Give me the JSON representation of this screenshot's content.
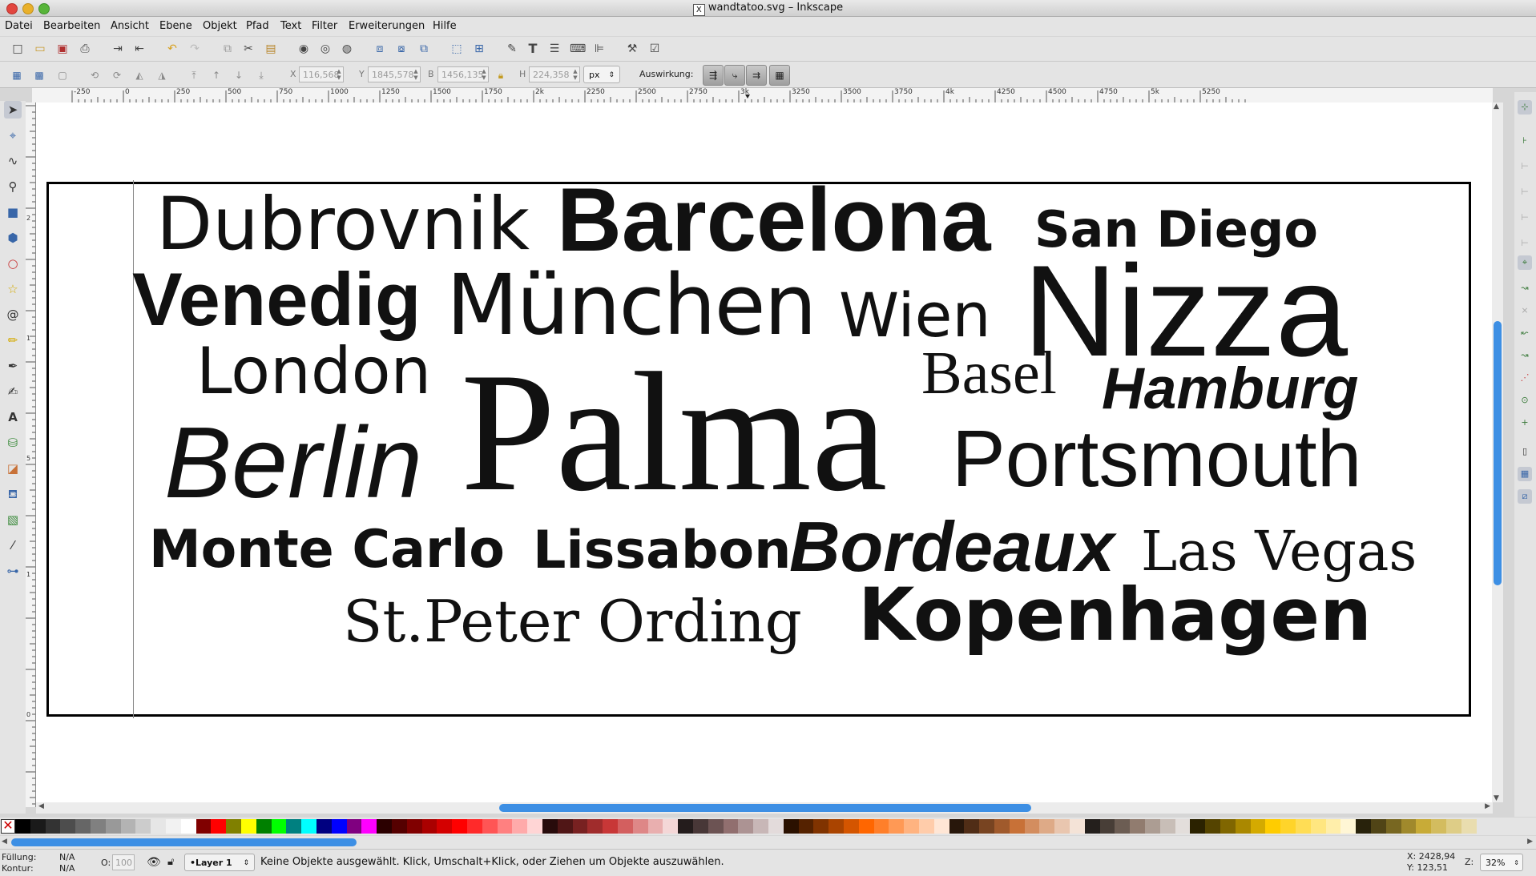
{
  "window": {
    "title": "wandtatoo.svg – Inkscape",
    "x11_glyph": "X"
  },
  "menu": [
    "Datei",
    "Bearbeiten",
    "Ansicht",
    "Ebene",
    "Objekt",
    "Pfad",
    "Text",
    "Filter",
    "Erweiterungen",
    "Hilfe"
  ],
  "toolbar1": {
    "icons": [
      "new-document-icon",
      "open-icon",
      "save-icon",
      "print-icon",
      "import-icon",
      "export-icon",
      "undo-icon",
      "redo-icon",
      "duplicate-icon",
      "cut-icon",
      "paste-icon",
      "zoom-selection-icon",
      "zoom-drawing-icon",
      "zoom-page-icon",
      "group-icon",
      "ungroup-icon",
      "clone-icon",
      "zoom-fit-icon",
      "zoom-1to1-icon",
      "fill-stroke-icon",
      "text-tool-icon",
      "layers-icon",
      "xml-editor-icon",
      "align-icon",
      "preferences-icon",
      "document-properties-icon"
    ]
  },
  "toolbar2": {
    "x_label": "X",
    "x_value": "116,568",
    "y_label": "Y",
    "y_value": "1845,578",
    "w_label": "B",
    "w_value": "1456,135",
    "h_label": "H",
    "h_value": "224,358",
    "unit": "px",
    "affect_label": "Auswirkung:"
  },
  "ruler_h": {
    "labels": [
      "-250",
      "0",
      "250",
      "500",
      "750",
      "1000",
      "1250",
      "1500",
      "1750",
      "2k",
      "2250",
      "2500",
      "2750",
      "3k",
      "3250",
      "3500",
      "3750",
      "4k",
      "4250",
      "4500",
      "4750",
      "5k",
      "5250"
    ]
  },
  "ruler_v": {
    "labels": [
      "2",
      "1",
      "5",
      "1",
      "0",
      "5",
      "0"
    ]
  },
  "canvas": {
    "words": [
      {
        "text": "Dubrovnik"
      },
      {
        "text": "Barcelona"
      },
      {
        "text": "San Diego"
      },
      {
        "text": "Venedig"
      },
      {
        "text": "München"
      },
      {
        "text": "Wien"
      },
      {
        "text": "Nizza"
      },
      {
        "text": "London"
      },
      {
        "text": "Basel"
      },
      {
        "text": "Hamburg"
      },
      {
        "text": "Palma"
      },
      {
        "text": "Berlin"
      },
      {
        "text": "Portsmouth"
      },
      {
        "text": "Monte Carlo"
      },
      {
        "text": "Lissabon"
      },
      {
        "text": "Bordeaux"
      },
      {
        "text": "Las Vegas"
      },
      {
        "text": "St.Peter Ording"
      },
      {
        "text": "Kopenhagen"
      }
    ]
  },
  "palette": {
    "colors": [
      "#000000",
      "#1a1a1a",
      "#333333",
      "#4d4d4d",
      "#666666",
      "#808080",
      "#999999",
      "#b3b3b3",
      "#cccccc",
      "#e6e6e6",
      "#f2f2f2",
      "#ffffff",
      "#800000",
      "#ff0000",
      "#808000",
      "#ffff00",
      "#008000",
      "#00ff00",
      "#008080",
      "#00ffff",
      "#000080",
      "#0000ff",
      "#800080",
      "#ff00ff",
      "#2b0000",
      "#550000",
      "#800000",
      "#aa0000",
      "#d40000",
      "#ff0000",
      "#ff2a2a",
      "#ff5555",
      "#ff8080",
      "#ffaaaa",
      "#ffd5d5",
      "#280b0b",
      "#501616",
      "#782121",
      "#a02c2c",
      "#c83737",
      "#d35f5f",
      "#de8787",
      "#e9afaf",
      "#f4d7d7",
      "#241c1c",
      "#483737",
      "#6c5353",
      "#916f6f",
      "#ac9393",
      "#c8b7b7",
      "#e3dbdb",
      "#2b1100",
      "#552200",
      "#803300",
      "#aa4400",
      "#d45500",
      "#ff6600",
      "#ff7f2a",
      "#ff9955",
      "#ffb380",
      "#ffccaa",
      "#ffe6d5",
      "#28170b",
      "#502d16",
      "#784421",
      "#a05a2c",
      "#c87137",
      "#d38d5f",
      "#deaa87",
      "#e9c6af",
      "#f4e3d7",
      "#241f1c",
      "#483e37",
      "#6c5d53",
      "#917c6f",
      "#ac9d93",
      "#c8beb7",
      "#e3dedb",
      "#2b2200",
      "#554400",
      "#806600",
      "#aa8800",
      "#d4aa00",
      "#ffcc00",
      "#ffd42a",
      "#ffdd55",
      "#ffe680",
      "#ffeeaa",
      "#fff6d5",
      "#28220b",
      "#504416",
      "#786721",
      "#a0892c",
      "#c8ab37",
      "#d3bc5f",
      "#decd87",
      "#e9ddaf"
    ]
  },
  "status": {
    "fill_label": "Füllung:",
    "fill_value": "N/A",
    "stroke_label": "Kontur:",
    "stroke_value": "N/A",
    "opacity_label": "O:",
    "opacity_value": "100",
    "layer": "•Layer 1",
    "message": "Keine Objekte ausgewählt. Klick, Umschalt+Klick, oder Ziehen um Objekte auszuwählen.",
    "cursor_x": "X: 2428,94",
    "cursor_y": "Y: 123,51",
    "zoom_label": "Z:",
    "zoom_value": "32%"
  }
}
